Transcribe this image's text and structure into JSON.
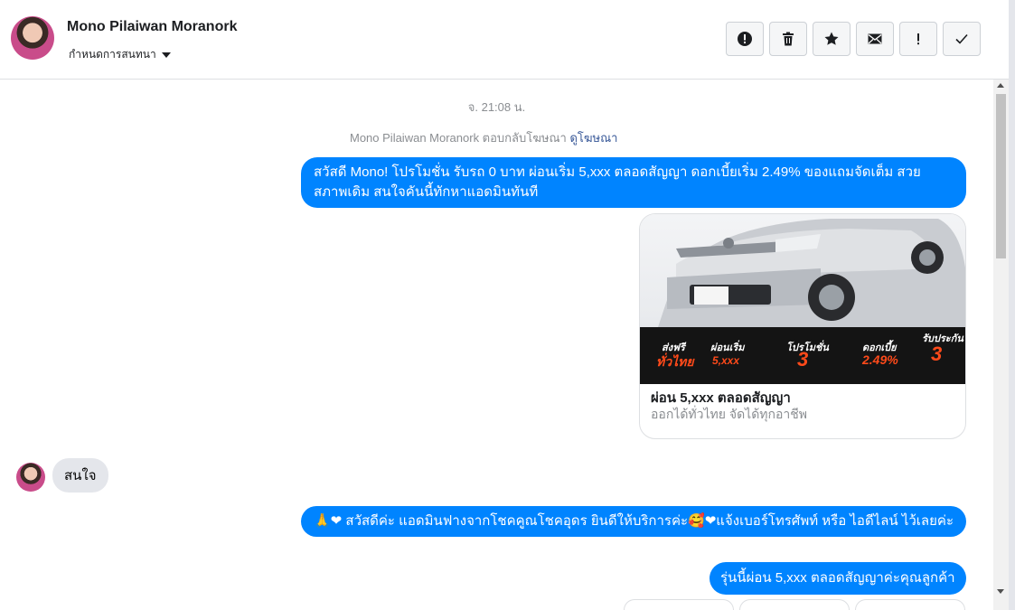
{
  "header": {
    "name": "Mono Pilaiwan Moranork",
    "subtitle": "กำหนดการสนทนา",
    "tools": [
      {
        "name": "report",
        "icon": "alert-circle-icon"
      },
      {
        "name": "delete",
        "icon": "trash-icon"
      },
      {
        "name": "star",
        "icon": "star-icon"
      },
      {
        "name": "mark-unread",
        "icon": "envelope-icon"
      },
      {
        "name": "spam",
        "icon": "exclamation-icon"
      },
      {
        "name": "done",
        "icon": "check-icon"
      }
    ]
  },
  "conversation": {
    "timestamp": "จ. 21:08 น.",
    "reply_note": {
      "text": "Mono Pilaiwan Moranork ตอบกลับโฆษณา",
      "link": "ดูโฆษณา"
    },
    "messages": [
      {
        "from": "page",
        "text": "สวัสดี Mono! โปรโมชั่น รับรถ 0 บาท ผ่อนเริ่ม 5,xxx ตลอดสัญญา ดอกเบี้ยเริ่ม 2.49% ของแถมจัดเต็ม สวยสภาพเดิม สนใจคันนี้ทักหาแอดมินทันที"
      },
      {
        "from": "page",
        "type": "card",
        "title": "ผ่อน 5,xxx ตลอดสัญญา",
        "subtitle": "ออกได้ทั่วไทย จัดได้ทุกอาชีพ",
        "promo": [
          {
            "label": "ส่งฟรี",
            "value": "ทั่วไทย"
          },
          {
            "label": "ผ่อนเริ่ม",
            "value": "5,xxx"
          },
          {
            "label": "โปรโมชั่น",
            "value": "3"
          },
          {
            "label": "ดอกเบี้ย",
            "value": "2.49%"
          },
          {
            "label": "รับประกัน",
            "value": "3"
          }
        ]
      },
      {
        "from": "user",
        "text": "สนใจ"
      },
      {
        "from": "page",
        "text": "🙏❤ สวัสดีค่ะ แอดมินฟางจากโชคคูณโชคอุดร ยินดีให้บริการค่ะ🥰❤แจ้งเบอร์โทรศัพท์ หรือ ไอดีไลน์  ไว้เลยค่ะ"
      },
      {
        "from": "page",
        "text": "รุ่นนี้ผ่อน 5,xxx ตลอดสัญญาค่ะคุณลูกค้า"
      }
    ]
  },
  "colors": {
    "bubble_out": "#0084ff",
    "bubble_in": "#e4e6eb",
    "link": "#385898",
    "promo_accent": "#ff4a1a"
  }
}
